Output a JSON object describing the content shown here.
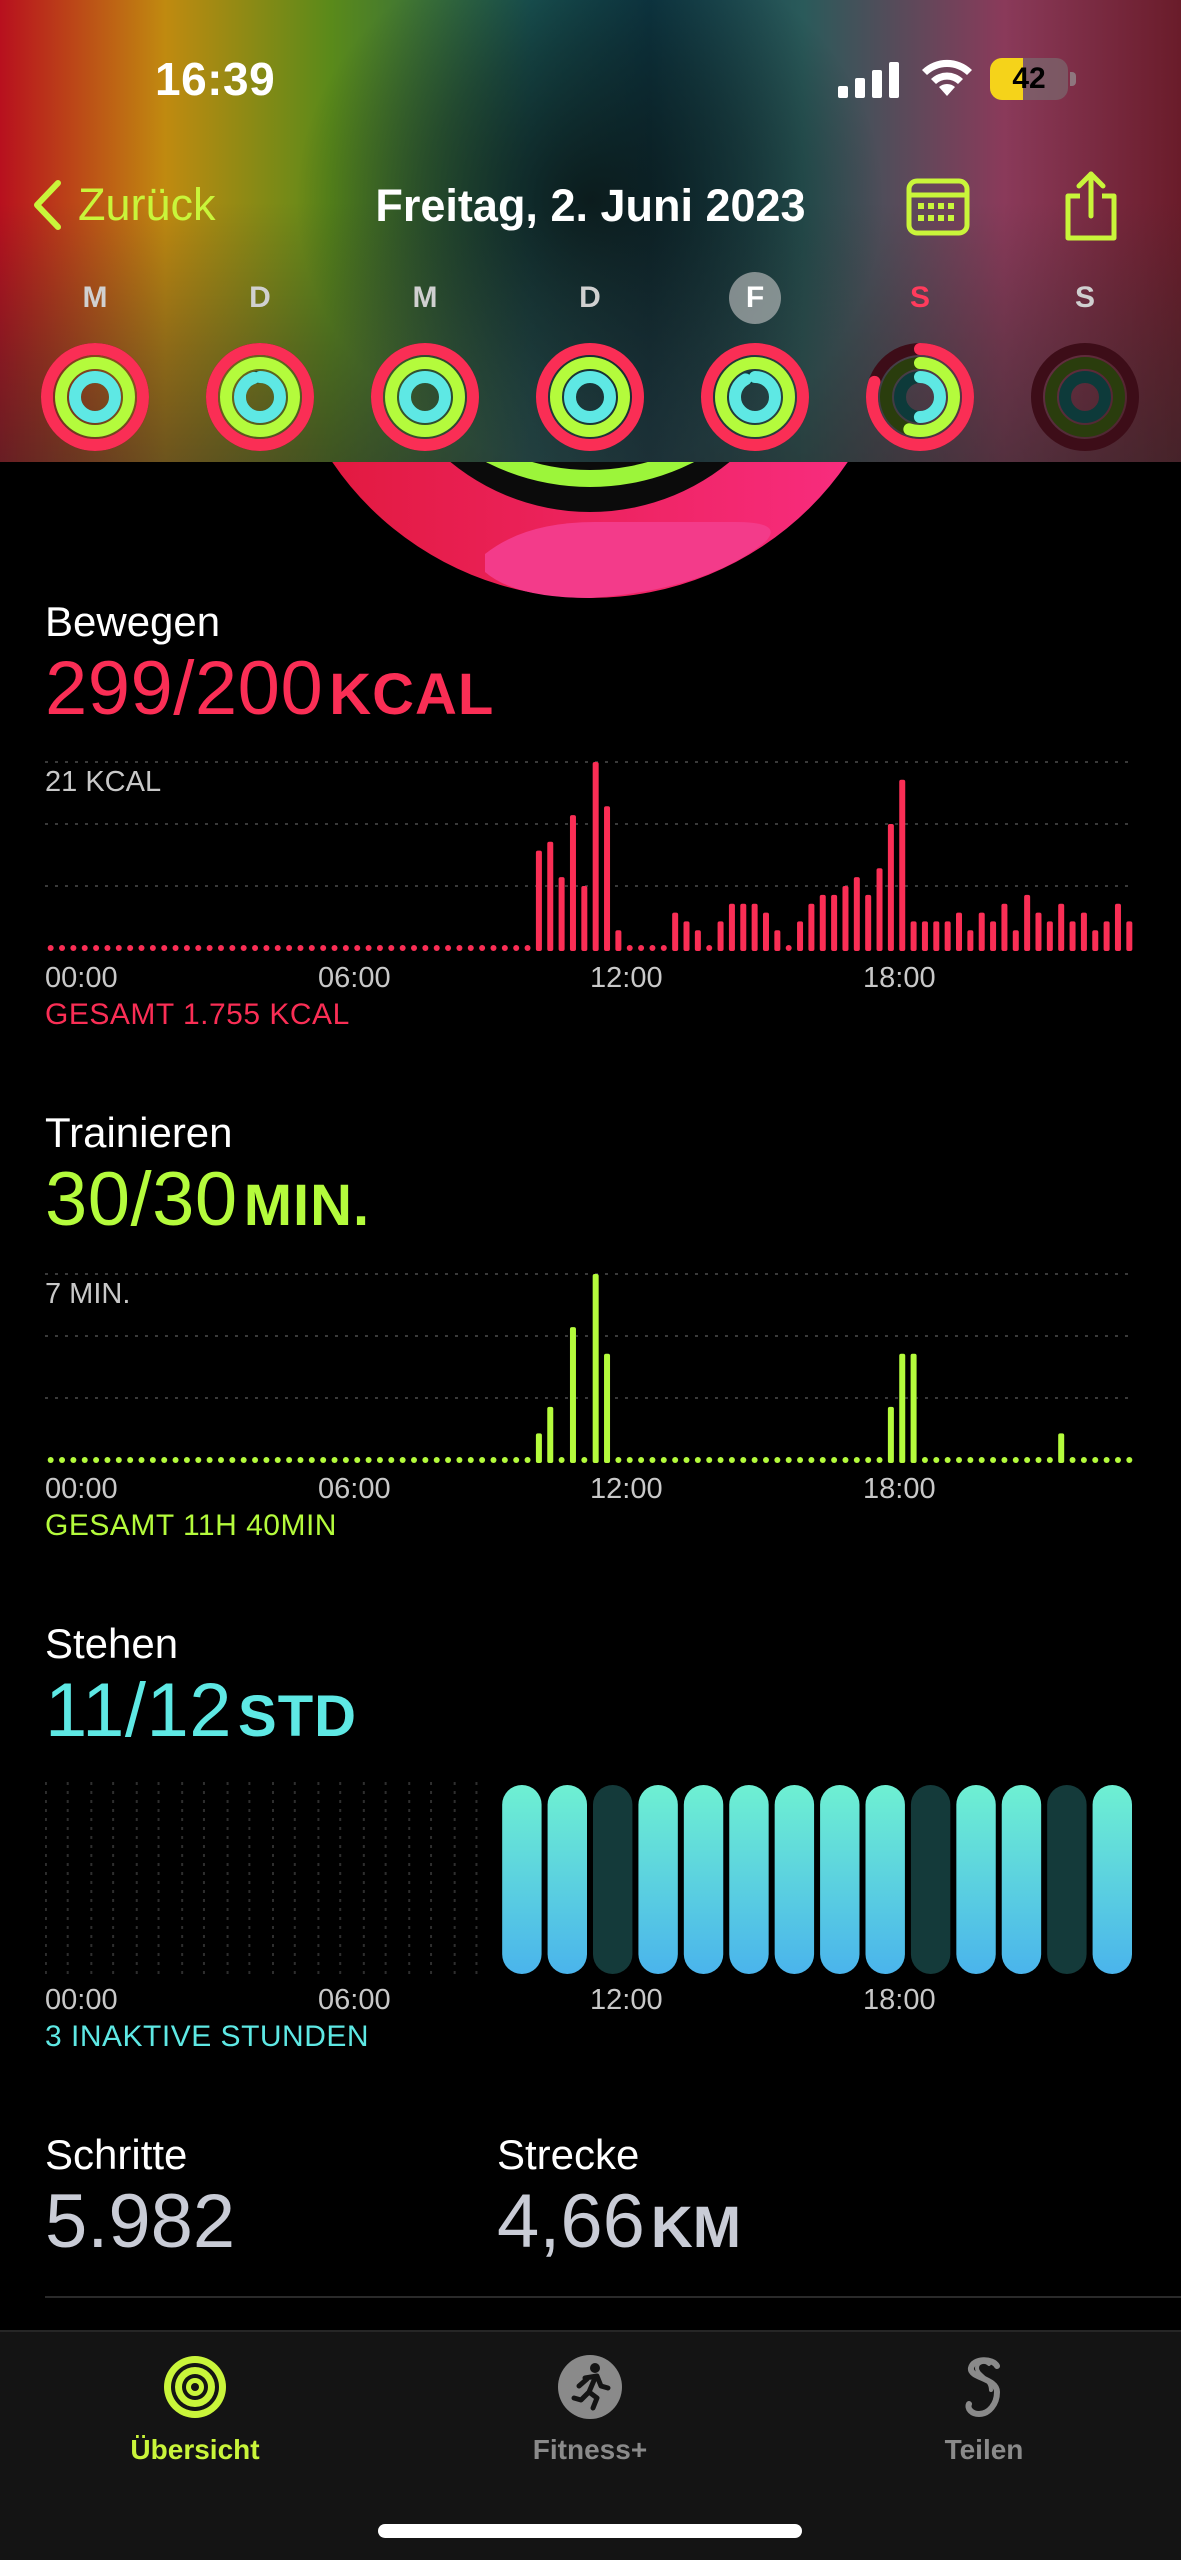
{
  "status": {
    "time": "16:39",
    "battery": "42",
    "battery_percent": 42
  },
  "nav": {
    "back_label": "Zurück",
    "title": "Freitag, 2. Juni 2023"
  },
  "weekdays": [
    {
      "letter": "M",
      "move": 1.0,
      "exercise": 1.0,
      "stand": 1.0
    },
    {
      "letter": "D",
      "move": 1.0,
      "exercise": 1.0,
      "stand": 0.95
    },
    {
      "letter": "M",
      "move": 1.0,
      "exercise": 1.0,
      "stand": 1.0
    },
    {
      "letter": "D",
      "move": 1.0,
      "exercise": 1.0,
      "stand": 1.0
    },
    {
      "letter": "F",
      "move": 1.0,
      "exercise": 1.0,
      "stand": 0.92,
      "selected": true
    },
    {
      "letter": "S",
      "move": 0.8,
      "exercise": 0.55,
      "stand": 0.5,
      "weekend": true
    },
    {
      "letter": "S",
      "move": 0.0,
      "exercise": 0.0,
      "stand": 0.0
    }
  ],
  "move": {
    "title": "Bewegen",
    "value": "299/200",
    "unit": "KCAL",
    "peak_label": "21 KCAL",
    "total": "GESAMT 1.755 KCAL",
    "color": "#fa2e55"
  },
  "exercise": {
    "title": "Trainieren",
    "value": "30/30",
    "unit": "MIN.",
    "peak_label": "7 MIN.",
    "total": "GESAMT 11H 40MIN",
    "color": "#b4fb3c"
  },
  "stand": {
    "title": "Stehen",
    "value": "11/12",
    "unit": "STD",
    "total": "3 INAKTIVE STUNDEN",
    "color": "#5ee8e4"
  },
  "axis_ticks": [
    "00:00",
    "06:00",
    "12:00",
    "18:00"
  ],
  "steps": {
    "title": "Schritte",
    "value": "5.982"
  },
  "distance": {
    "title": "Strecke",
    "value": "4,66",
    "unit": "KM"
  },
  "tabs": [
    {
      "label": "Übersicht",
      "icon": "activity-rings-icon",
      "active": true
    },
    {
      "label": "Fitness+",
      "icon": "runner-icon",
      "active": false
    },
    {
      "label": "Teilen",
      "icon": "sharing-icon",
      "active": false
    }
  ],
  "chart_data": [
    {
      "type": "bar",
      "title": "Bewegen",
      "x_unit": "15 min slot index (0-95)",
      "x_tick_labels": [
        "00:00",
        "06:00",
        "12:00",
        "18:00"
      ],
      "ylabel": "KCAL",
      "ylim": [
        0,
        21
      ],
      "values": [
        0,
        0,
        0,
        0,
        0,
        0,
        0,
        0,
        0,
        0,
        0,
        0,
        0,
        0,
        0,
        0,
        0,
        0,
        0,
        0,
        0,
        0,
        0,
        0,
        0,
        0,
        0,
        0,
        0,
        0,
        0,
        0,
        0,
        0,
        0,
        0,
        0,
        0,
        0,
        0,
        0,
        0,
        0,
        11,
        12,
        8,
        15,
        7,
        21,
        16,
        2,
        0,
        0,
        0,
        0,
        4,
        3,
        2,
        0,
        3,
        5,
        5,
        5,
        4,
        2,
        0,
        3,
        5,
        6,
        6,
        7,
        8,
        6,
        9,
        14,
        19,
        3,
        3,
        3,
        3,
        4,
        2,
        4,
        3,
        5,
        2,
        6,
        4,
        3,
        5,
        3,
        4,
        2,
        3,
        5,
        3
      ],
      "baseline_dots": true
    },
    {
      "type": "bar",
      "title": "Trainieren",
      "x_unit": "15 min slot index (0-95)",
      "x_tick_labels": [
        "00:00",
        "06:00",
        "12:00",
        "18:00"
      ],
      "ylabel": "MIN.",
      "ylim": [
        0,
        7
      ],
      "values": [
        0,
        0,
        0,
        0,
        0,
        0,
        0,
        0,
        0,
        0,
        0,
        0,
        0,
        0,
        0,
        0,
        0,
        0,
        0,
        0,
        0,
        0,
        0,
        0,
        0,
        0,
        0,
        0,
        0,
        0,
        0,
        0,
        0,
        0,
        0,
        0,
        0,
        0,
        0,
        0,
        0,
        0,
        0,
        1,
        2,
        0,
        5,
        0,
        7,
        4,
        0,
        0,
        0,
        0,
        0,
        0,
        0,
        0,
        0,
        0,
        0,
        0,
        0,
        0,
        0,
        0,
        0,
        0,
        0,
        0,
        0,
        0,
        0,
        0,
        2,
        4,
        4,
        0,
        0,
        0,
        0,
        0,
        0,
        0,
        0,
        0,
        0,
        0,
        0,
        1,
        0,
        0,
        0,
        0,
        0,
        0
      ],
      "baseline_dots": true
    },
    {
      "type": "bar",
      "title": "Stehen",
      "x_unit": "hour of day",
      "x_tick_labels": [
        "00:00",
        "06:00",
        "12:00",
        "18:00"
      ],
      "values": [
        0,
        0,
        0,
        0,
        0,
        0,
        0,
        0,
        0,
        0,
        1,
        1,
        0,
        1,
        1,
        1,
        1,
        1,
        1,
        0,
        1,
        1,
        0,
        1
      ],
      "legend": "1 = stand goal hour achieved, 0 = inactive hour"
    }
  ]
}
